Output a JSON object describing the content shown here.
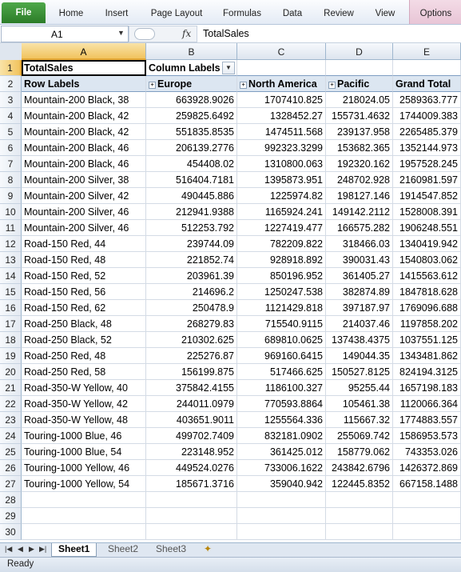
{
  "ribbon": {
    "tabs": [
      "File",
      "Home",
      "Insert",
      "Page Layout",
      "Formulas",
      "Data",
      "Review",
      "View",
      "Options"
    ]
  },
  "formula_bar": {
    "name_box": "A1",
    "formula": "TotalSales",
    "fx_label": "fx"
  },
  "columns": [
    "A",
    "B",
    "C",
    "D",
    "E"
  ],
  "pivot": {
    "value_label": "TotalSales",
    "column_labels": "Column Labels",
    "row_labels": "Row Labels",
    "headers": [
      "Europe",
      "North America",
      "Pacific",
      "Grand Total"
    ],
    "rows": [
      [
        "Mountain-200 Black, 38",
        "663928.9026",
        "1707410.825",
        "218024.05",
        "2589363.777"
      ],
      [
        "Mountain-200 Black, 42",
        "259825.6492",
        "1328452.27",
        "155731.4632",
        "1744009.383"
      ],
      [
        "Mountain-200 Black, 42",
        "551835.8535",
        "1474511.568",
        "239137.958",
        "2265485.379"
      ],
      [
        "Mountain-200 Black, 46",
        "206139.2776",
        "992323.3299",
        "153682.365",
        "1352144.973"
      ],
      [
        "Mountain-200 Black, 46",
        "454408.02",
        "1310800.063",
        "192320.162",
        "1957528.245"
      ],
      [
        "Mountain-200 Silver, 38",
        "516404.7181",
        "1395873.951",
        "248702.928",
        "2160981.597"
      ],
      [
        "Mountain-200 Silver, 42",
        "490445.886",
        "1225974.82",
        "198127.146",
        "1914547.852"
      ],
      [
        "Mountain-200 Silver, 46",
        "212941.9388",
        "1165924.241",
        "149142.2112",
        "1528008.391"
      ],
      [
        "Mountain-200 Silver, 46",
        "512253.792",
        "1227419.477",
        "166575.282",
        "1906248.551"
      ],
      [
        "Road-150 Red, 44",
        "239744.09",
        "782209.822",
        "318466.03",
        "1340419.942"
      ],
      [
        "Road-150 Red, 48",
        "221852.74",
        "928918.892",
        "390031.43",
        "1540803.062"
      ],
      [
        "Road-150 Red, 52",
        "203961.39",
        "850196.952",
        "361405.27",
        "1415563.612"
      ],
      [
        "Road-150 Red, 56",
        "214696.2",
        "1250247.538",
        "382874.89",
        "1847818.628"
      ],
      [
        "Road-150 Red, 62",
        "250478.9",
        "1121429.818",
        "397187.97",
        "1769096.688"
      ],
      [
        "Road-250 Black, 48",
        "268279.83",
        "715540.9115",
        "214037.46",
        "1197858.202"
      ],
      [
        "Road-250 Black, 52",
        "210302.625",
        "689810.0625",
        "137438.4375",
        "1037551.125"
      ],
      [
        "Road-250 Red, 48",
        "225276.87",
        "969160.6415",
        "149044.35",
        "1343481.862"
      ],
      [
        "Road-250 Red, 58",
        "156199.875",
        "517466.625",
        "150527.8125",
        "824194.3125"
      ],
      [
        "Road-350-W Yellow, 40",
        "375842.4155",
        "1186100.327",
        "95255.44",
        "1657198.183"
      ],
      [
        "Road-350-W Yellow, 42",
        "244011.0979",
        "770593.8864",
        "105461.38",
        "1120066.364"
      ],
      [
        "Road-350-W Yellow, 48",
        "403651.9011",
        "1255564.336",
        "115667.32",
        "1774883.557"
      ],
      [
        "Touring-1000 Blue, 46",
        "499702.7409",
        "832181.0902",
        "255069.742",
        "1586953.573"
      ],
      [
        "Touring-1000 Blue, 54",
        "223148.952",
        "361425.012",
        "158779.062",
        "743353.026"
      ],
      [
        "Touring-1000 Yellow, 46",
        "449524.0276",
        "733006.1622",
        "243842.6796",
        "1426372.869"
      ],
      [
        "Touring-1000 Yellow, 54",
        "185671.3716",
        "359040.942",
        "122445.8352",
        "667158.1488"
      ]
    ]
  },
  "row_numbers": [
    "1",
    "2",
    "3",
    "4",
    "5",
    "6",
    "7",
    "8",
    "9",
    "10",
    "11",
    "12",
    "13",
    "14",
    "15",
    "16",
    "17",
    "18",
    "19",
    "20",
    "21",
    "22",
    "23",
    "24",
    "25",
    "26",
    "27",
    "28",
    "29",
    "30"
  ],
  "sheets": [
    "Sheet1",
    "Sheet2",
    "Sheet3"
  ],
  "status": "Ready"
}
